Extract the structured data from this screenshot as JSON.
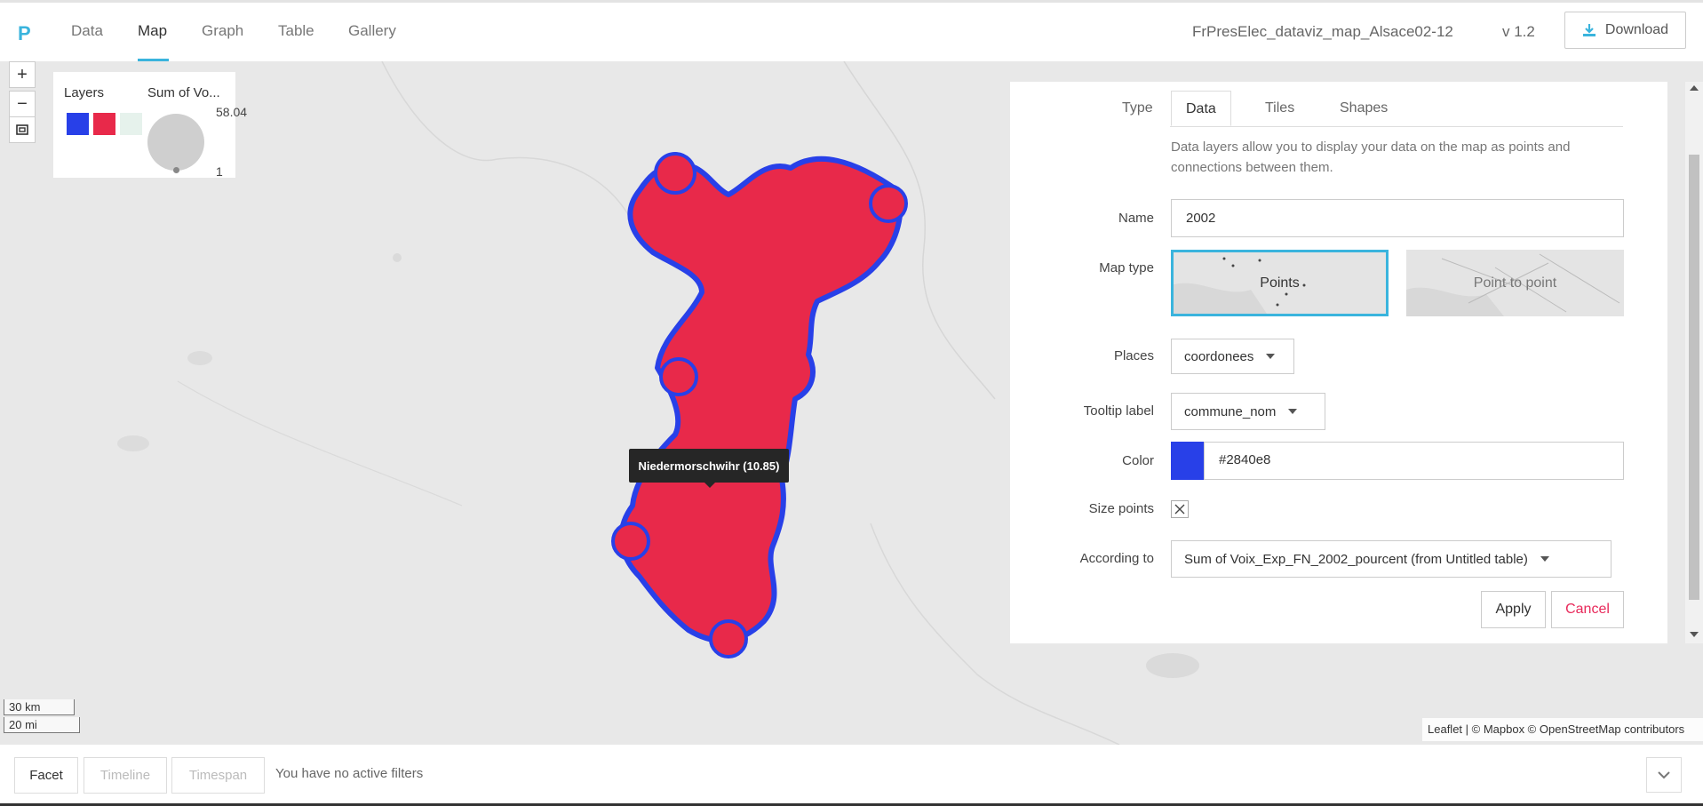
{
  "app": {
    "logo": "P",
    "tabs": [
      "Data",
      "Map",
      "Graph",
      "Table",
      "Gallery"
    ],
    "active_tab": "Map",
    "project_name": "FrPresElec_dataviz_map_Alsace02-12",
    "version": "v 1.2",
    "download_label": "Download"
  },
  "map": {
    "zoom_in": "+",
    "zoom_out": "−",
    "legend": {
      "layers_label": "Layers",
      "size_label": "Sum of Vo...",
      "max_value": "58.04",
      "min_value": "1",
      "layer_colors": [
        "#2840e8",
        "#e8294a",
        "#e6f2ec"
      ]
    },
    "tooltip": "Niedermorschwihr (10.85)",
    "scale": {
      "km": "30 km",
      "mi": "20 mi"
    },
    "attribution": "Leaflet | © Mapbox © OpenStreetMap contributors",
    "point_fill_color": "#e8294a",
    "point_stroke_color": "#2840e8"
  },
  "panel": {
    "tabs": [
      "Type",
      "Data",
      "Tiles",
      "Shapes"
    ],
    "active_tab": "Data",
    "description": "Data layers allow you to display your data on the map as points and connections between them.",
    "name_label": "Name",
    "name_value": "2002",
    "map_type_label": "Map type",
    "map_type_options": [
      "Points",
      "Point to point"
    ],
    "map_type_selected": "Points",
    "places_label": "Places",
    "places_value": "coordonees",
    "tooltip_label": "Tooltip label",
    "tooltip_value": "commune_nom",
    "color_label": "Color",
    "color_value": "#2840e8",
    "size_points_label": "Size points",
    "according_label": "According to",
    "according_value": "Sum of Voix_Exp_FN_2002_pourcent (from Untitled table)",
    "apply_label": "Apply",
    "cancel_label": "Cancel",
    "accent_color": "#3ab4dd",
    "cancel_color": "#e8295a"
  },
  "filters": {
    "facet_label": "Facet",
    "timeline_label": "Timeline",
    "timespan_label": "Timespan",
    "status": "You have no active filters"
  }
}
